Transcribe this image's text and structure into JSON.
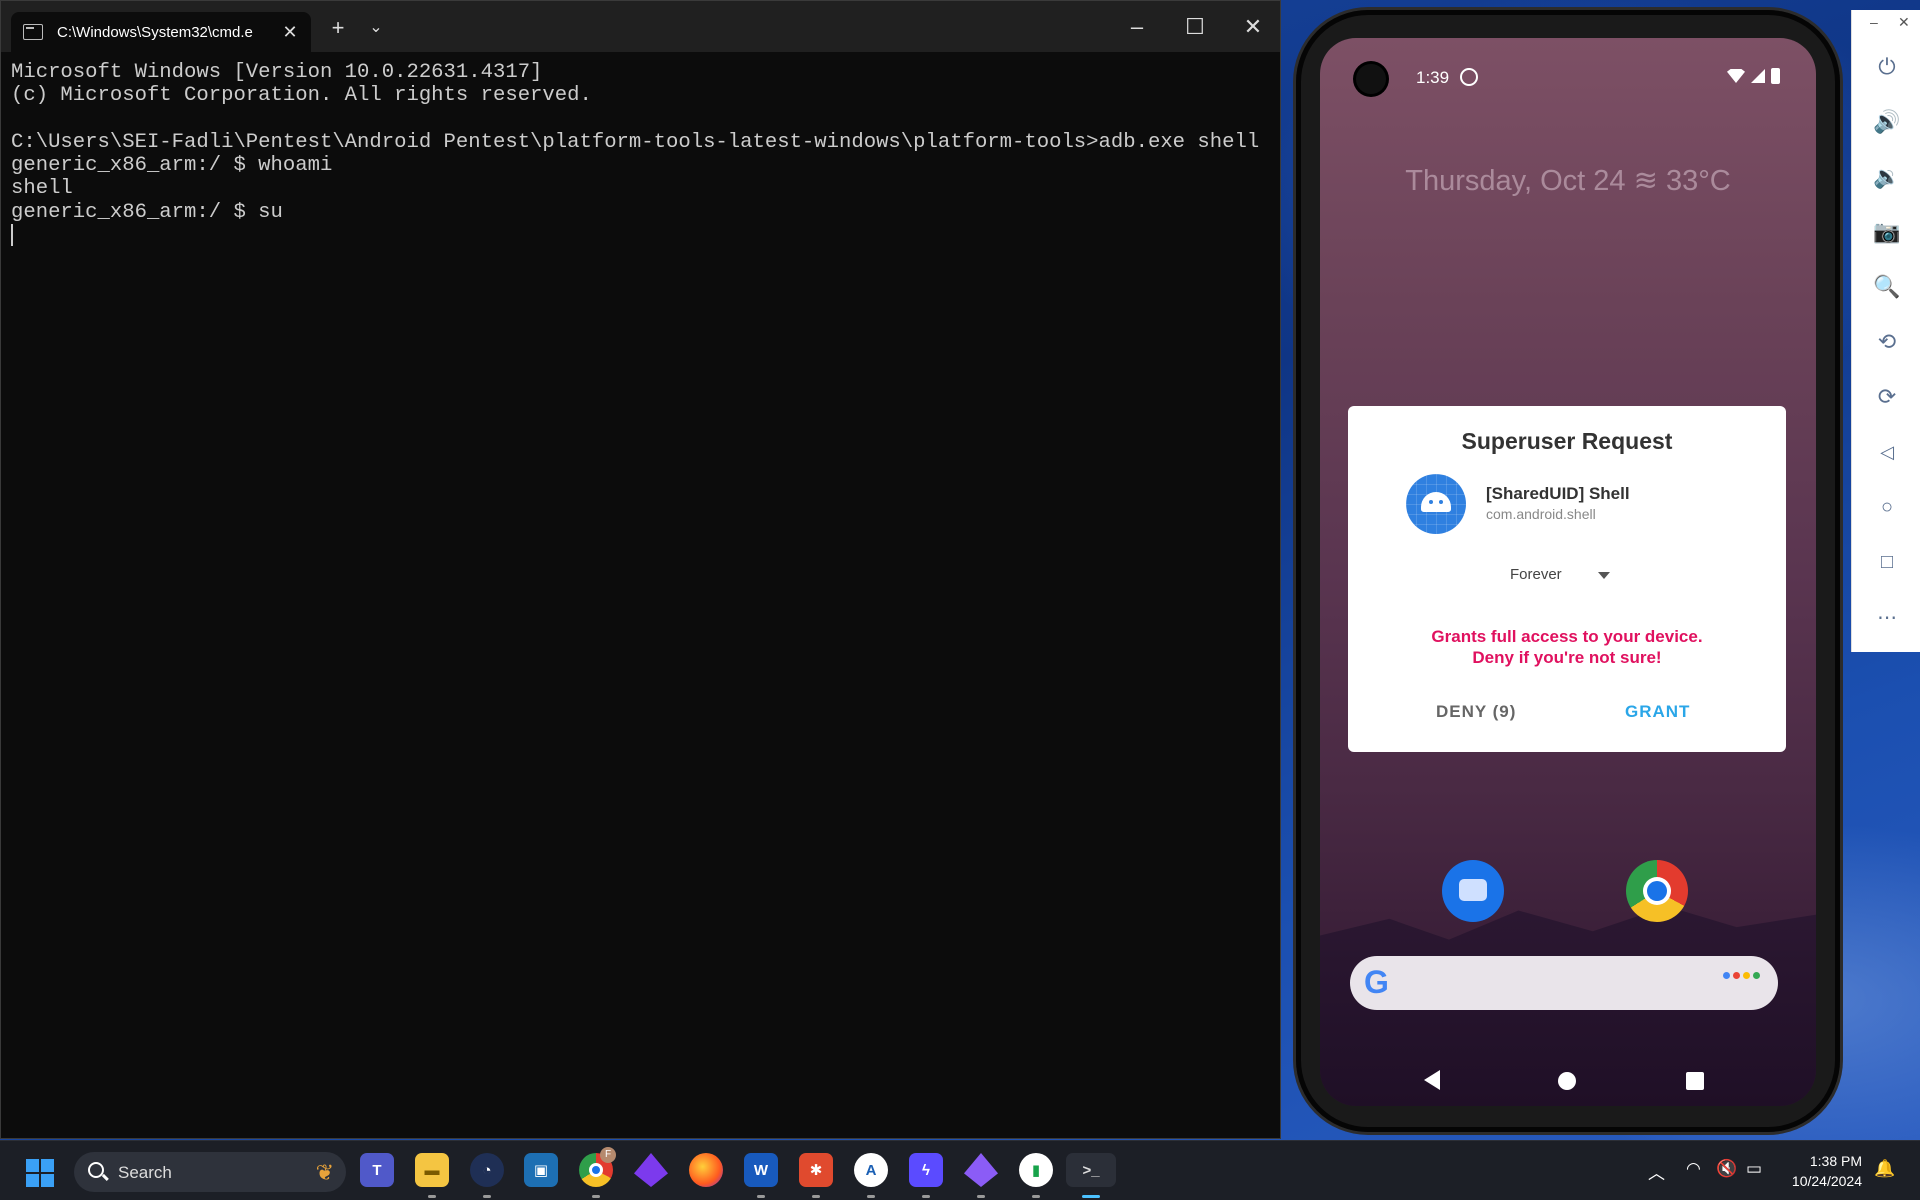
{
  "terminal": {
    "tab_title": "C:\\Windows\\System32\\cmd.e",
    "lines": [
      "Microsoft Windows [Version 10.0.22631.4317]",
      "(c) Microsoft Corporation. All rights reserved.",
      "",
      "C:\\Users\\SEI-Fadli\\Pentest\\Android Pentest\\platform-tools-latest-windows\\platform-tools>adb.exe shell",
      "generic_x86_arm:/ $ whoami",
      "shell",
      "generic_x86_arm:/ $ su"
    ],
    "new_tab_icon": "plus-icon",
    "dropdown_icon": "chevron-down-icon",
    "minimize_label": "–",
    "maximize_label": "☐",
    "close_label": "✕"
  },
  "phone": {
    "time": "1:39",
    "date_weather": "Thursday, Oct 24 ≋ 33°C",
    "dialog": {
      "title": "Superuser Request",
      "app_name": "[SharedUID] Shell",
      "app_package": "com.android.shell",
      "duration": "Forever",
      "warning_line1": "Grants full access to your device.",
      "warning_line2": "Deny if you're not sure!",
      "deny_label": "DENY (9)",
      "grant_label": "GRANT"
    },
    "colors": {
      "grant": "#2aa6e8",
      "warning": "#e0115f",
      "app_icon": "#2f80e0"
    }
  },
  "emulator_toolbar": {
    "minimize": "–",
    "close": "✕",
    "buttons": [
      "power-icon",
      "volume-up-icon",
      "volume-down-icon",
      "camera-icon",
      "zoom-icon",
      "rotate-left-icon",
      "rotate-right-icon",
      "back-icon",
      "home-icon",
      "overview-icon",
      "more-icon"
    ]
  },
  "taskbar": {
    "search_placeholder": "Search",
    "apps": [
      "teams",
      "file-explorer",
      "vpn-client",
      "virtualbox",
      "chrome",
      "obsidian",
      "firefox",
      "word",
      "xmind",
      "android-studio",
      "ultraviolet",
      "obsidian-2",
      "app-notepad",
      "terminal"
    ],
    "chrome_badge": "F",
    "clock_time": "1:38 PM",
    "clock_date": "10/24/2024"
  }
}
